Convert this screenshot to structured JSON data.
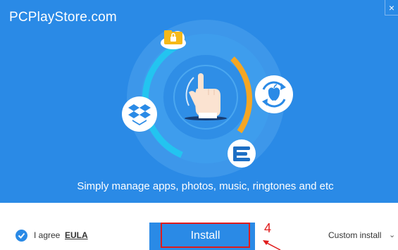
{
  "brand": {
    "watermark": "PCPlayStore.com"
  },
  "window": {
    "close_glyph": "×"
  },
  "hero": {
    "tagline": "Simply manage apps, photos, music, ringtones and etc"
  },
  "icons": [
    "folder-lock-icon",
    "dropbox-icon",
    "apple-sync-icon",
    "app-e-icon",
    "hand-pointer-icon",
    "check-icon"
  ],
  "footer": {
    "agree_label": "I agree",
    "eula_link": "EULA",
    "install_label": "Install",
    "custom_install_label": "Custom install",
    "custom_install_chevron": "⌄"
  },
  "annotation": {
    "step_number": "4"
  },
  "colors": {
    "primary_blue": "#2a8ae6",
    "accent_orange": "#f5a623",
    "annotation_red": "#e01b1b"
  }
}
